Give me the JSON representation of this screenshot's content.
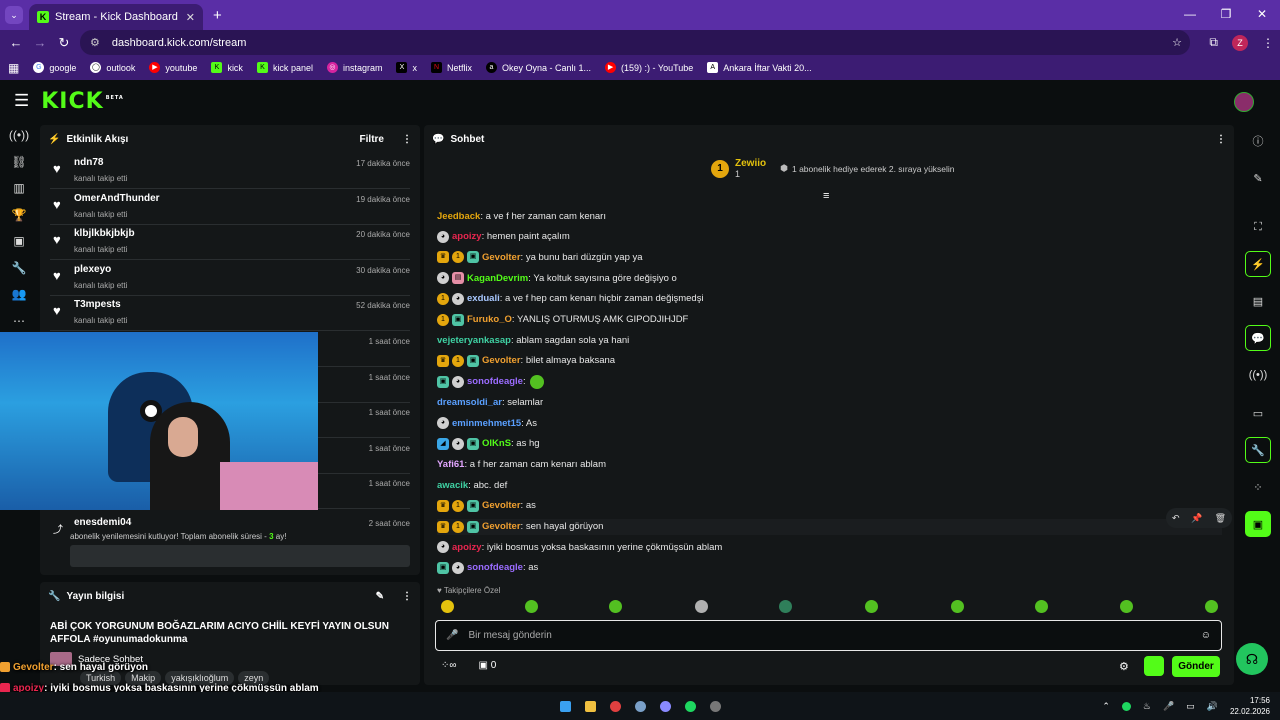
{
  "browser": {
    "tab_title": "Stream - Kick Dashboard",
    "url": "dashboard.kick.com/stream",
    "profile_letter": "Z",
    "bookmarks": [
      "google",
      "outlook",
      "youtube",
      "kick",
      "kick panel",
      "instagram",
      "x",
      "Netflix",
      "Okey Oyna - Canlı 1...",
      "(159) :) - YouTube",
      "Ankara İftar Vakti 20..."
    ]
  },
  "header": {
    "logo": "KICK",
    "beta": "BETA"
  },
  "activity": {
    "title": "Etkinlik Akışı",
    "filter_label": "Filtre",
    "events": [
      {
        "name": "ndn78",
        "sub": "kanalı takip etti",
        "time": "17 dakika önce"
      },
      {
        "name": "OmerAndThunder",
        "sub": "kanalı takip etti",
        "time": "19 dakika önce"
      },
      {
        "name": "klbjlkbkjbkjb",
        "sub": "kanalı takip etti",
        "time": "20 dakika önce"
      },
      {
        "name": "plexeyo",
        "sub": "kanalı takip etti",
        "time": "30 dakika önce"
      },
      {
        "name": "T3mpests",
        "sub": "kanalı takip etti",
        "time": "52 dakika önce"
      },
      {
        "name": "",
        "sub": "",
        "time": "1 saat önce"
      },
      {
        "name": "",
        "sub": "",
        "time": "1 saat önce"
      },
      {
        "name": "",
        "sub": "",
        "time": "1 saat önce"
      },
      {
        "name": "",
        "sub": "",
        "time": "1 saat önce"
      },
      {
        "name": "",
        "sub": "",
        "time": "1 saat önce"
      }
    ],
    "sub_event": {
      "name": "enesdemi04",
      "time": "2 saat önce",
      "text": "abonelik yenilemesini kutluyor! Toplam abonelik süresi - ",
      "months": "3",
      "months_suffix": " ay!"
    }
  },
  "stream_info": {
    "title": "Yayın bilgisi",
    "stream_title": "ABİ ÇOK YORGUNUM BOĞAZLARIM ACIYO CHİİL KEYFİ YAYIN OLSUN AFFOLA #oyunumadokunma",
    "category": "Sadece Sohbet",
    "tags": [
      "Turkish",
      "Makip",
      "yakışıklıoğlum",
      "zeyn"
    ]
  },
  "chat": {
    "title": "Sohbet",
    "top_gifter": {
      "name": "Zewiio",
      "count": "1",
      "rank": "1",
      "hint": "1 abonelik hediye ederek 2. sıraya yükselin"
    },
    "messages": [
      {
        "badges": [],
        "user": "Jeedback",
        "color": "#e4a60d",
        "text": ": a ve f her zaman cam kenarı"
      },
      {
        "badges": [
          "cat"
        ],
        "user": "apoizy",
        "color": "#e8264f",
        "text": ": hemen paint açalım"
      },
      {
        "badges": [
          "crown",
          "one",
          "gift"
        ],
        "user": "Gevolter",
        "color": "#f0a030",
        "text": ": ya bunu bari düzgün yap ya"
      },
      {
        "badges": [
          "cat",
          "pink"
        ],
        "user": "KaganDevrim",
        "color": "#53fc18",
        "text": ": Ya koltuk sayısına göre değişiyo o"
      },
      {
        "badges": [
          "one",
          "cat"
        ],
        "user": "exduali",
        "color": "#a8c8ff",
        "text": ": a ve f hep cam kenarı hiçbir zaman değişmedşi"
      },
      {
        "badges": [
          "one",
          "gift"
        ],
        "user": "Furuko_O",
        "color": "#f0a030",
        "text": ": YANLIŞ OTURMUŞ AMK GIPODJIHJDF"
      },
      {
        "badges": [],
        "user": "vejeteryankasap",
        "color": "#3fd1a3",
        "text": ": ablam sagdan sola ya hani"
      },
      {
        "badges": [
          "crown",
          "one",
          "gift"
        ],
        "user": "Gevolter",
        "color": "#f0a030",
        "text": ": bilet almaya baksana"
      },
      {
        "badges": [
          "gift",
          "cat"
        ],
        "user": "sonofdeagle",
        "color": "#9b6cff",
        "text": ": "
      },
      {
        "badges": [],
        "user": "dreamsoldi_ar",
        "color": "#5aa0ff",
        "text": ": selamlar"
      },
      {
        "badges": [
          "cat"
        ],
        "user": "eminmehmet15",
        "color": "#5aa0ff",
        "text": ": As"
      },
      {
        "badges": [
          "fire",
          "cat",
          "gift"
        ],
        "user": "OlKnS",
        "color": "#53fc18",
        "text": ": as hg"
      },
      {
        "badges": [],
        "user": "Yafi61",
        "color": "#e2a6ff",
        "text": ": a f her zaman cam kenarı ablam"
      },
      {
        "badges": [],
        "user": "awacik",
        "color": "#3fd1a3",
        "text": ": abc. def"
      },
      {
        "badges": [
          "crown",
          "one",
          "gift"
        ],
        "user": "Gevolter",
        "color": "#f0a030",
        "text": ": as"
      },
      {
        "badges": [
          "crown",
          "one",
          "gift"
        ],
        "user": "Gevolter",
        "color": "#f0a030",
        "text": ": sen hayal görüyon"
      },
      {
        "badges": [
          "cat"
        ],
        "user": "apoizy",
        "color": "#e8264f",
        "text": ": iyiki bosmus yoksa baskasının yerine çökmüşsün ablam"
      },
      {
        "badges": [
          "gift",
          "cat"
        ],
        "user": "sonofdeagle",
        "color": "#9b6cff",
        "text": ": as"
      }
    ],
    "followers_only": "Takipçilere Özel",
    "input_placeholder": "Bir mesaj gönderin",
    "send_label": "Gönder",
    "count": "0"
  },
  "overlay_lines": [
    {
      "user": "Gevolter",
      "text": ": sen hayal görüyon"
    },
    {
      "user": "apoizy",
      "text": ": iyiki bosmus yoksa baskasının yerine çökmüşsün ablam"
    },
    {
      "user": "sonofdeagle",
      "text": ": as"
    }
  ],
  "taskbar": {
    "time": "17:56",
    "date": "22.02.2026"
  }
}
